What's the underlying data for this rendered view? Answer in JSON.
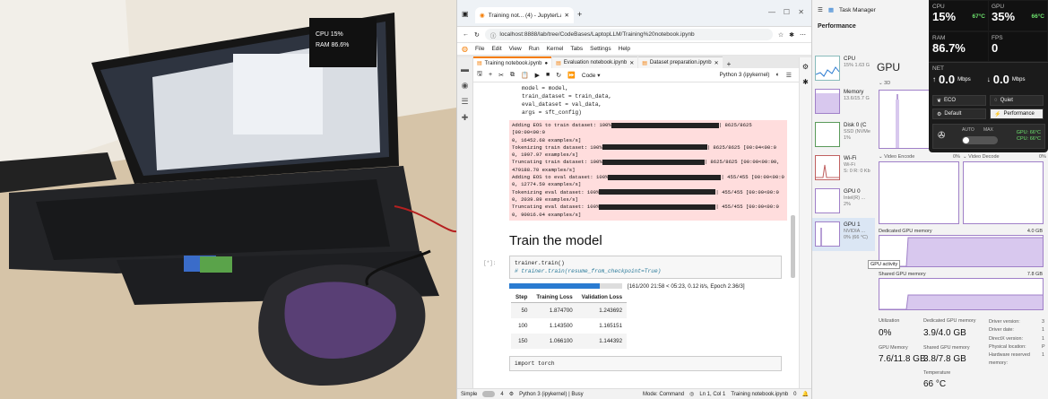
{
  "browser": {
    "tab_title": "Training not... (4) - JupyterLab",
    "url": "localhost:8888/lab/tree/CodeBases/LaptopLLM/Training%20notebook.ipynb"
  },
  "jupyter": {
    "menu": [
      "File",
      "Edit",
      "View",
      "Run",
      "Kernel",
      "Tabs",
      "Settings",
      "Help"
    ],
    "notebook_tabs": [
      "Training notebook.ipynb",
      "Evaluation notebook.ipynb",
      "Dataset preparation.ipynb"
    ],
    "cell_type": "Code",
    "kernel": "Python 3 (ipykernel)",
    "code_lines": [
      "model = model,",
      "train_dataset = train_data,",
      "eval_dataset = val_data,",
      "args = sft_config)"
    ],
    "stderr_lines": [
      "Adding EOS to train dataset: 100%",
      "| 8625/8625 [00:00<00:0",
      "0, 16452.68 examples/s]",
      "Tokenizing train dataset: 100%",
      "| 8625/8625 [00:04<00:0",
      "0, 1997.97 examples/s]",
      "Truncating train dataset: 100%",
      "| 8625/8625 [00:00<00:00,",
      "479188.70 examples/s]",
      "Adding EOS to eval dataset: 100%",
      "| 455/455 [00:00<00:0",
      "0, 12774.50 examples/s]",
      "Tokenizing eval dataset: 100%",
      "| 455/455 [00:00<00:0",
      "0, 2039.89 examples/s]",
      "Truncating eval dataset: 100%",
      "| 455/455 [00:00<00:0",
      "0, 90016.04 examples/s]"
    ],
    "heading": "Train the model",
    "cell_prompt": "[*]:",
    "train_line": "trainer.train()",
    "train_comment": "# trainer.train(resume_from_checkpoint=True)",
    "progress_value": 0.805,
    "progress_text": "[161/200 21:58 < 05:23, 0.12 it/s, Epoch 2.36/3]",
    "table_headers": [
      "Step",
      "Training Loss",
      "Validation Loss"
    ],
    "table_rows": [
      [
        "50",
        "1.874700",
        "1.243692"
      ],
      [
        "100",
        "1.143500",
        "1.165151"
      ],
      [
        "150",
        "1.066100",
        "1.144392"
      ]
    ],
    "next_code": "import torch",
    "status": {
      "simple": "Simple",
      "count": "4",
      "kernel": "Python 3 (ipykernel) | Busy",
      "mode": "Mode: Command",
      "cursor": "Ln 1, Col 1",
      "file": "Training notebook.ipynb",
      "notif": "0"
    }
  },
  "taskmanager": {
    "title": "Task Manager",
    "section": "Performance",
    "items": [
      {
        "name": "CPU",
        "sub": "15% 1.63 G"
      },
      {
        "name": "Memory",
        "sub": "13.6/15.7 G"
      },
      {
        "name": "Disk 0 (C",
        "sub": "SSD (NVMe",
        "sub2": "1%"
      },
      {
        "name": "Wi-Fi",
        "sub": "Wi-Fi",
        "sub2": "S: 0 R: 0 Kb"
      },
      {
        "name": "GPU 0",
        "sub": "Intel(R) ...",
        "sub2": "2%"
      },
      {
        "name": "GPU 1",
        "sub": "NVIDIA ...",
        "sub2": "0% (66 °C)"
      }
    ],
    "gpu_title": "GPU",
    "tab_3d": "3D",
    "video_encode": "Video Encode",
    "video_encode_pct": "0%",
    "video_decode": "Video Decode",
    "video_decode_pct": "0%",
    "dedicated_label": "Dedicated GPU memory",
    "dedicated_max": "4.0 GB",
    "shared_label": "Shared GPU memory",
    "shared_max": "7.8 GB",
    "tooltip": "GPU activity",
    "utilization_label": "Utilization",
    "utilization": "0%",
    "ded_mem_label": "Dedicated GPU memory",
    "ded_mem": "3.9/4.0 GB",
    "gpu_mem_label": "GPU Memory",
    "gpu_mem": "7.6/11.8 GB",
    "shared_mem_label": "Shared GPU memory",
    "shared_mem": "3.8/7.8 GB",
    "temp_label": "Temperature",
    "temp": "66 °C",
    "driver_keys": [
      "Driver version:",
      "Driver date:",
      "DirectX version:",
      "Physical location:",
      "Hardware reserved memory:"
    ],
    "driver_vals": [
      "3",
      "1",
      "1",
      "P",
      "1"
    ]
  },
  "overlay": {
    "cpu_label": "CPU",
    "cpu": "15%",
    "cpu_temp": "67°C",
    "gpu_label": "GPU",
    "gpu": "35%",
    "gpu_temp": "66°C",
    "ram_label": "RAM",
    "ram": "86.7%",
    "fps_label": "FPS",
    "fps": "0",
    "net_label": "NET",
    "net_up": "0.0",
    "net_down": "0.0",
    "net_unit": "Mbps",
    "modes": [
      "ECO",
      "Quiet",
      "Default",
      "Performance"
    ],
    "auto": "AUTO",
    "max": "MAX",
    "gpu_temp_line": "GPU: 66°C",
    "cpu_temp_line": "CPU: 66°C"
  }
}
